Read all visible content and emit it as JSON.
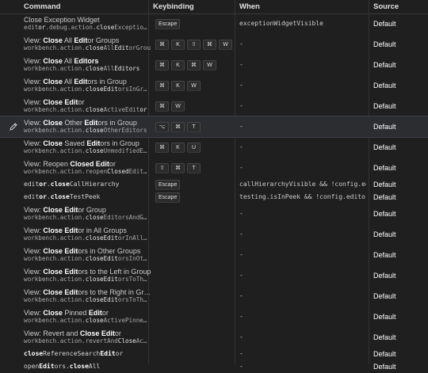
{
  "headers": {
    "command": "Command",
    "keybinding": "Keybinding",
    "when": "When",
    "source": "Source"
  },
  "icons": {
    "edit": "pencil-icon"
  },
  "rows": [
    {
      "title_parts": [
        {
          "t": "Close Exception Widget",
          "b": false
        }
      ],
      "id_parts": [
        {
          "t": "edit",
          "b": false
        },
        {
          "t": "or",
          "b": true
        },
        {
          "t": ".debug.action.",
          "b": false
        },
        {
          "t": "close",
          "b": true
        },
        {
          "t": "Exceptio…",
          "b": false
        }
      ],
      "keys": [
        "Escape"
      ],
      "when": "exceptionWidgetVisible",
      "source": "Default"
    },
    {
      "title_parts": [
        {
          "t": "View: ",
          "b": false
        },
        {
          "t": "Close",
          "b": true
        },
        {
          "t": " All ",
          "b": false
        },
        {
          "t": "Edit",
          "b": true
        },
        {
          "t": "or Groups",
          "b": false
        }
      ],
      "id_parts": [
        {
          "t": "workbench.action.",
          "b": false
        },
        {
          "t": "close",
          "b": true
        },
        {
          "t": "All",
          "b": false
        },
        {
          "t": "Edit",
          "b": true
        },
        {
          "t": "orGroups",
          "b": false
        }
      ],
      "keys": [
        "⌘",
        "K",
        "⇧",
        "⌘",
        "W"
      ],
      "when": "-",
      "source": "Default"
    },
    {
      "title_parts": [
        {
          "t": "View: ",
          "b": false
        },
        {
          "t": "Close",
          "b": true
        },
        {
          "t": " All ",
          "b": false
        },
        {
          "t": "Editors",
          "b": true
        }
      ],
      "id_parts": [
        {
          "t": "workbench.action.",
          "b": false
        },
        {
          "t": "close",
          "b": true
        },
        {
          "t": "All",
          "b": false
        },
        {
          "t": "Editors",
          "b": true
        }
      ],
      "keys": [
        "⌘",
        "K",
        "⌘",
        "W"
      ],
      "when": "-",
      "source": "Default"
    },
    {
      "title_parts": [
        {
          "t": "View: ",
          "b": false
        },
        {
          "t": "Close",
          "b": true
        },
        {
          "t": " All ",
          "b": false
        },
        {
          "t": "Edit",
          "b": true
        },
        {
          "t": "ors in Group",
          "b": false
        }
      ],
      "id_parts": [
        {
          "t": "workbench.action.",
          "b": false
        },
        {
          "t": "close",
          "b": true
        },
        {
          "t": "Edit",
          "b": true
        },
        {
          "t": "orsInGr…",
          "b": false
        }
      ],
      "keys": [
        "⌘",
        "K",
        "W"
      ],
      "when": "-",
      "source": "Default"
    },
    {
      "title_parts": [
        {
          "t": "View: ",
          "b": false
        },
        {
          "t": "Close Edit",
          "b": true
        },
        {
          "t": "or",
          "b": false
        }
      ],
      "id_parts": [
        {
          "t": "workbench.action.",
          "b": false
        },
        {
          "t": "close",
          "b": true
        },
        {
          "t": "ActiveEdit",
          "b": false
        },
        {
          "t": "or",
          "b": true
        }
      ],
      "keys": [
        "⌘",
        "W"
      ],
      "when": "-",
      "source": "Default"
    },
    {
      "title_parts": [
        {
          "t": "View: ",
          "b": false
        },
        {
          "t": "Close",
          "b": true
        },
        {
          "t": " Other ",
          "b": false
        },
        {
          "t": "Edit",
          "b": true
        },
        {
          "t": "ors in Group",
          "b": false
        }
      ],
      "id_parts": [
        {
          "t": "workbench.action.",
          "b": false
        },
        {
          "t": "close",
          "b": true
        },
        {
          "t": "OtherEditors",
          "b": false
        }
      ],
      "keys": [
        "⌥",
        "⌘",
        "T"
      ],
      "when": "-",
      "source": "Default",
      "focused": true
    },
    {
      "title_parts": [
        {
          "t": "View: ",
          "b": false
        },
        {
          "t": "Close",
          "b": true
        },
        {
          "t": " Saved ",
          "b": false
        },
        {
          "t": "Edit",
          "b": true
        },
        {
          "t": "ors in Group",
          "b": false
        }
      ],
      "id_parts": [
        {
          "t": "workbench.action.",
          "b": false
        },
        {
          "t": "close",
          "b": true
        },
        {
          "t": "UnmodifiedE…",
          "b": false
        }
      ],
      "keys": [
        "⌘",
        "K",
        "U"
      ],
      "when": "-",
      "source": "Default"
    },
    {
      "title_parts": [
        {
          "t": "View: Reopen ",
          "b": false
        },
        {
          "t": "Closed Edit",
          "b": true
        },
        {
          "t": "or",
          "b": false
        }
      ],
      "id_parts": [
        {
          "t": "workbench.action.reopen",
          "b": false
        },
        {
          "t": "Closed",
          "b": true
        },
        {
          "t": "Edit…",
          "b": false
        }
      ],
      "keys": [
        "⇧",
        "⌘",
        "T"
      ],
      "when": "-",
      "source": "Default"
    },
    {
      "mono_parts": [
        {
          "t": "edit",
          "b": false
        },
        {
          "t": "or",
          "b": true
        },
        {
          "t": ".",
          "b": false
        },
        {
          "t": "close",
          "b": true
        },
        {
          "t": "CallHierarchy",
          "b": false
        }
      ],
      "keys": [
        "Escape"
      ],
      "when": "callHierarchyVisible && !config.ed…",
      "source": "Default"
    },
    {
      "mono_parts": [
        {
          "t": "edit",
          "b": false
        },
        {
          "t": "or",
          "b": true
        },
        {
          "t": ".",
          "b": false
        },
        {
          "t": "close",
          "b": true
        },
        {
          "t": "TestPeek",
          "b": false
        }
      ],
      "keys": [
        "Escape"
      ],
      "when": "testing.isInPeek && !config.editor…",
      "source": "Default"
    },
    {
      "title_parts": [
        {
          "t": "View: ",
          "b": false
        },
        {
          "t": "Close Edit",
          "b": true
        },
        {
          "t": "or Group",
          "b": false
        }
      ],
      "id_parts": [
        {
          "t": "workbench.action.",
          "b": false
        },
        {
          "t": "close",
          "b": true
        },
        {
          "t": "EditorsAndG…",
          "b": false
        }
      ],
      "keys": [],
      "when": "-",
      "source": "Default"
    },
    {
      "title_parts": [
        {
          "t": "View: ",
          "b": false
        },
        {
          "t": "Close Edit",
          "b": true
        },
        {
          "t": "or in All Groups",
          "b": false
        }
      ],
      "id_parts": [
        {
          "t": "workbench.action.",
          "b": false
        },
        {
          "t": "close",
          "b": true
        },
        {
          "t": "Edit",
          "b": true
        },
        {
          "t": "orInAll…",
          "b": false
        }
      ],
      "keys": [],
      "when": "-",
      "source": "Default"
    },
    {
      "title_parts": [
        {
          "t": "View: ",
          "b": false
        },
        {
          "t": "Close Edit",
          "b": true
        },
        {
          "t": "ors in Other Groups",
          "b": false
        }
      ],
      "id_parts": [
        {
          "t": "workbench.action.",
          "b": false
        },
        {
          "t": "close",
          "b": true
        },
        {
          "t": "Edit",
          "b": true
        },
        {
          "t": "orsInOt…",
          "b": false
        }
      ],
      "keys": [],
      "when": "-",
      "source": "Default"
    },
    {
      "title_parts": [
        {
          "t": "View: ",
          "b": false
        },
        {
          "t": "Close Edit",
          "b": true
        },
        {
          "t": "ors to the Left in Group",
          "b": false
        }
      ],
      "id_parts": [
        {
          "t": "workbench.action.",
          "b": false
        },
        {
          "t": "close",
          "b": true
        },
        {
          "t": "Edit",
          "b": true
        },
        {
          "t": "orsToTh…",
          "b": false
        }
      ],
      "keys": [],
      "when": "-",
      "source": "Default"
    },
    {
      "title_parts": [
        {
          "t": "View: ",
          "b": false
        },
        {
          "t": "Close Edit",
          "b": true
        },
        {
          "t": "ors to the Right in Gr…",
          "b": false
        }
      ],
      "id_parts": [
        {
          "t": "workbench.action.",
          "b": false
        },
        {
          "t": "close",
          "b": true
        },
        {
          "t": "Edit",
          "b": true
        },
        {
          "t": "orsToTh…",
          "b": false
        }
      ],
      "keys": [],
      "when": "-",
      "source": "Default"
    },
    {
      "title_parts": [
        {
          "t": "View: ",
          "b": false
        },
        {
          "t": "Close",
          "b": true
        },
        {
          "t": " Pinned ",
          "b": false
        },
        {
          "t": "Edit",
          "b": true
        },
        {
          "t": "or",
          "b": false
        }
      ],
      "id_parts": [
        {
          "t": "workbench.action.",
          "b": false
        },
        {
          "t": "close",
          "b": true
        },
        {
          "t": "ActivePinne…",
          "b": false
        }
      ],
      "keys": [],
      "when": "-",
      "source": "Default"
    },
    {
      "title_parts": [
        {
          "t": "View: Revert and ",
          "b": false
        },
        {
          "t": "Close Edit",
          "b": true
        },
        {
          "t": "or",
          "b": false
        }
      ],
      "id_parts": [
        {
          "t": "workbench.action.revertAnd",
          "b": false
        },
        {
          "t": "Close",
          "b": true
        },
        {
          "t": "Ac…",
          "b": false
        }
      ],
      "keys": [],
      "when": "-",
      "source": "Default"
    },
    {
      "mono_parts": [
        {
          "t": "close",
          "b": true
        },
        {
          "t": "ReferenceSearch",
          "b": false
        },
        {
          "t": "Edit",
          "b": true
        },
        {
          "t": "or",
          "b": false
        }
      ],
      "keys": [],
      "when": "-",
      "source": "Default"
    },
    {
      "mono_parts": [
        {
          "t": "open",
          "b": false
        },
        {
          "t": "Edit",
          "b": true
        },
        {
          "t": "ors.",
          "b": false
        },
        {
          "t": "close",
          "b": true
        },
        {
          "t": "All",
          "b": false
        }
      ],
      "keys": [],
      "when": "-",
      "source": "Default"
    }
  ]
}
